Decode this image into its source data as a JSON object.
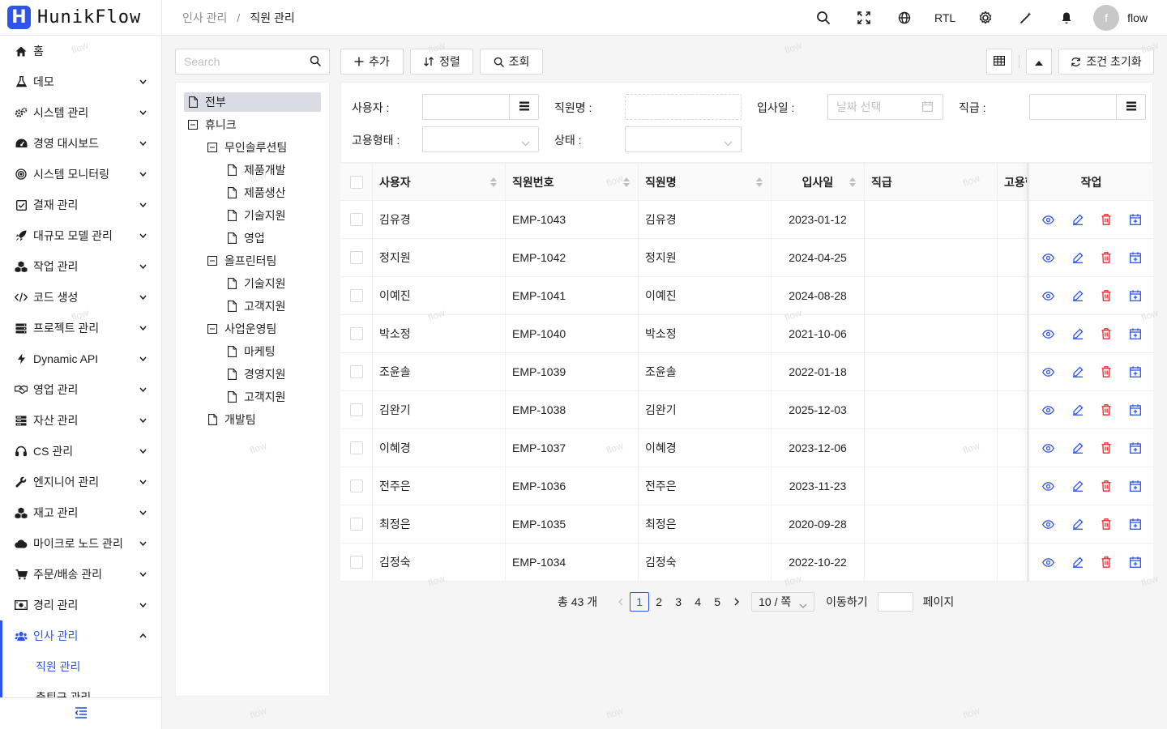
{
  "app": {
    "logo_letter": "H",
    "name": "HunikFlow"
  },
  "breadcrumb": {
    "parent": "인사 관리",
    "separator": "/",
    "current": "직원 관리"
  },
  "header": {
    "rtl_label": "RTL",
    "user_initial": "f",
    "user_name": "flow"
  },
  "sidebar": {
    "items": [
      {
        "label": "홈",
        "icon": "home-icon",
        "has_arrow": false
      },
      {
        "label": "데모",
        "icon": "flask-icon",
        "has_arrow": true
      },
      {
        "label": "시스템 관리",
        "icon": "cogs-icon",
        "has_arrow": true
      },
      {
        "label": "경영 대시보드",
        "icon": "gauge-icon",
        "has_arrow": true
      },
      {
        "label": "시스템 모니터링",
        "icon": "target-icon",
        "has_arrow": true
      },
      {
        "label": "결재 관리",
        "icon": "check-square-icon",
        "has_arrow": true
      },
      {
        "label": "대규모 모델 관리",
        "icon": "rocket-icon",
        "has_arrow": true
      },
      {
        "label": "작업 관리",
        "icon": "cubes-icon",
        "has_arrow": true
      },
      {
        "label": "코드 생성",
        "icon": "code-icon",
        "has_arrow": true
      },
      {
        "label": "프로젝트 관리",
        "icon": "server-icon",
        "has_arrow": true
      },
      {
        "label": "Dynamic API",
        "icon": "bolt-icon",
        "has_arrow": true
      },
      {
        "label": "영업 관리",
        "icon": "handshake-icon",
        "has_arrow": true
      },
      {
        "label": "자산 관리",
        "icon": "database-icon",
        "has_arrow": true
      },
      {
        "label": "CS 관리",
        "icon": "headset-icon",
        "has_arrow": true
      },
      {
        "label": "엔지니어 관리",
        "icon": "wrench-icon",
        "has_arrow": true
      },
      {
        "label": "재고 관리",
        "icon": "boxes-icon",
        "has_arrow": true
      },
      {
        "label": "마이크로 노드 관리",
        "icon": "cloud-icon",
        "has_arrow": true
      },
      {
        "label": "주문/배송 관리",
        "icon": "cart-icon",
        "has_arrow": true
      },
      {
        "label": "경리 관리",
        "icon": "money-icon",
        "has_arrow": true
      },
      {
        "label": "인사 관리",
        "icon": "users-icon",
        "has_arrow": true,
        "open": true
      }
    ],
    "sub_items": [
      {
        "label": "직원 관리",
        "active": true
      },
      {
        "label": "출퇴근 관리",
        "active": false
      }
    ]
  },
  "tree": {
    "search_placeholder": "Search",
    "nodes": [
      {
        "label": "전부",
        "level": 0,
        "type": "file",
        "selected": true
      },
      {
        "label": "휴니크",
        "level": 0,
        "type": "folder"
      },
      {
        "label": "무인솔루션팀",
        "level": 1,
        "type": "folder"
      },
      {
        "label": "제품개발",
        "level": 2,
        "type": "file"
      },
      {
        "label": "제품생산",
        "level": 2,
        "type": "file"
      },
      {
        "label": "기술지원",
        "level": 2,
        "type": "file"
      },
      {
        "label": "영업",
        "level": 2,
        "type": "file"
      },
      {
        "label": "올프린터팀",
        "level": 1,
        "type": "folder"
      },
      {
        "label": "기술지원",
        "level": 2,
        "type": "file"
      },
      {
        "label": "고객지원",
        "level": 2,
        "type": "file"
      },
      {
        "label": "사업운영팀",
        "level": 1,
        "type": "folder"
      },
      {
        "label": "마케팅",
        "level": 2,
        "type": "file"
      },
      {
        "label": "경영지원",
        "level": 2,
        "type": "file"
      },
      {
        "label": "고객지원",
        "level": 2,
        "type": "file"
      },
      {
        "label": "개발팀",
        "level": 1,
        "type": "file"
      }
    ]
  },
  "toolbar": {
    "add_label": "추가",
    "sort_label": "정렬",
    "search_label": "조회",
    "reset_label": "조건 초기화"
  },
  "filter": {
    "user_label": "사용자 :",
    "name_label": "직원명 :",
    "hire_label": "입사일 :",
    "hire_placeholder": "날짜 선택",
    "rank_label": "직급 :",
    "emp_type_label": "고용형태 :",
    "status_label": "상태 :"
  },
  "table": {
    "headers": {
      "user": "사용자",
      "emp_no": "직원번호",
      "name": "직원명",
      "hire_date": "입사일",
      "rank": "직급",
      "emp_type": "고용형",
      "action": "작업"
    },
    "rows": [
      {
        "user": "김유경",
        "emp_no": "EMP-1043",
        "name": "김유경",
        "hire_date": "2023-01-12"
      },
      {
        "user": "정지원",
        "emp_no": "EMP-1042",
        "name": "정지원",
        "hire_date": "2024-04-25"
      },
      {
        "user": "이예진",
        "emp_no": "EMP-1041",
        "name": "이예진",
        "hire_date": "2024-08-28"
      },
      {
        "user": "박소정",
        "emp_no": "EMP-1040",
        "name": "박소정",
        "hire_date": "2021-10-06"
      },
      {
        "user": "조윤솔",
        "emp_no": "EMP-1039",
        "name": "조윤솔",
        "hire_date": "2022-01-18"
      },
      {
        "user": "김완기",
        "emp_no": "EMP-1038",
        "name": "김완기",
        "hire_date": "2025-12-03"
      },
      {
        "user": "이혜경",
        "emp_no": "EMP-1037",
        "name": "이혜경",
        "hire_date": "2023-12-06"
      },
      {
        "user": "전주은",
        "emp_no": "EMP-1036",
        "name": "전주은",
        "hire_date": "2023-11-23"
      },
      {
        "user": "최정은",
        "emp_no": "EMP-1035",
        "name": "최정은",
        "hire_date": "2020-09-28"
      },
      {
        "user": "김정숙",
        "emp_no": "EMP-1034",
        "name": "김정숙",
        "hire_date": "2022-10-22"
      }
    ]
  },
  "pagination": {
    "total": "총 43 개",
    "pages": [
      "1",
      "2",
      "3",
      "4",
      "5"
    ],
    "current": "1",
    "page_size": "10 / 쪽",
    "jump_label": "이동하기",
    "jump_suffix": "페이지"
  },
  "watermark": "flow",
  "colors": {
    "primary": "#2f54eb",
    "danger": "#f5222d",
    "border": "#d9d9d9"
  }
}
